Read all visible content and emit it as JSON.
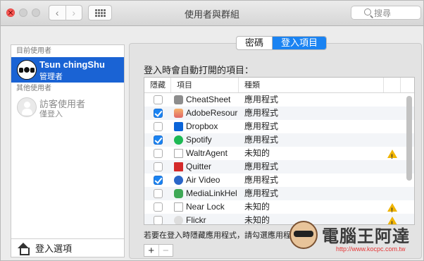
{
  "window": {
    "title": "使用者與群組",
    "search_placeholder": "搜尋"
  },
  "sidebar": {
    "current_users_label": "目前使用者",
    "current_user": {
      "name": "Tsun chingShu",
      "role": "管理者"
    },
    "other_users_label": "其他使用者",
    "guest_user": {
      "name": "訪客使用者",
      "role": "僅登入"
    },
    "login_options_label": "登入選項"
  },
  "tabs": [
    "密碼",
    "登入項目"
  ],
  "active_tab": "登入項目",
  "login_items": {
    "section_label": "登入時會自動打開的項目：",
    "columns": {
      "hide": "隱藏",
      "item": "項目",
      "kind": "種類"
    },
    "rows": [
      {
        "checked": false,
        "icon": "cheatsheet-icon",
        "name": "CheatSheet",
        "kind": "應用程式",
        "warning": false
      },
      {
        "checked": true,
        "icon": "adobe-resource-icon",
        "name": "AdobeResour",
        "kind": "應用程式",
        "warning": false
      },
      {
        "checked": false,
        "icon": "dropbox-icon",
        "name": "Dropbox",
        "kind": "應用程式",
        "warning": false
      },
      {
        "checked": true,
        "icon": "spotify-icon",
        "name": "Spotify",
        "kind": "應用程式",
        "warning": false
      },
      {
        "checked": false,
        "icon": "document-icon",
        "name": "WaltrAgent",
        "kind": "未知的",
        "warning": true
      },
      {
        "checked": false,
        "icon": "quitter-icon",
        "name": "Quitter",
        "kind": "應用程式",
        "warning": false
      },
      {
        "checked": true,
        "icon": "air-video-icon",
        "name": "Air Video",
        "kind": "應用程式",
        "warning": false
      },
      {
        "checked": false,
        "icon": "medialink-icon",
        "name": "MediaLinkHel",
        "kind": "應用程式",
        "warning": false
      },
      {
        "checked": false,
        "icon": "document-icon",
        "name": "Near Lock",
        "kind": "未知的",
        "warning": true
      },
      {
        "checked": false,
        "icon": "flickr-icon",
        "name": "Flickr",
        "kind": "未知的",
        "warning": true
      }
    ],
    "hint": "若要在登入時隱藏應用程式，請勾選應用程式"
  },
  "controls": {
    "add_label": "+",
    "remove_label": "−"
  },
  "watermark": {
    "text": "電腦王阿達",
    "url": "http://www.kocpc.com.tw"
  },
  "colors": {
    "accent": "#1a83f2",
    "selection": "#1a63d4",
    "warning": "#f0b400"
  }
}
